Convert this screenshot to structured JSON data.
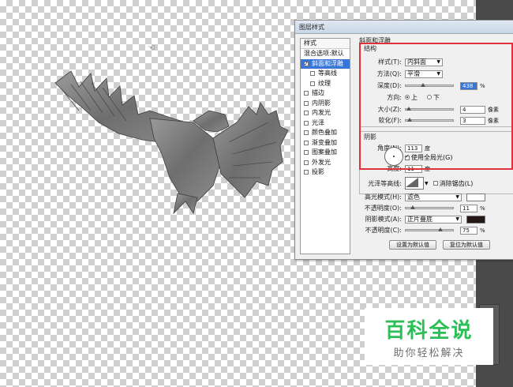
{
  "dialog": {
    "title": "图层样式",
    "left_header": "样式",
    "items": [
      {
        "label": "混合选项:默认",
        "checkbox": false,
        "sub": false,
        "selected": false
      },
      {
        "label": "斜面和浮雕",
        "checkbox": true,
        "checked": true,
        "sub": false,
        "selected": true
      },
      {
        "label": "等高线",
        "checkbox": true,
        "checked": false,
        "sub": true,
        "selected": false
      },
      {
        "label": "纹理",
        "checkbox": true,
        "checked": false,
        "sub": true,
        "selected": false
      },
      {
        "label": "描边",
        "checkbox": true,
        "checked": false,
        "sub": false,
        "selected": false
      },
      {
        "label": "内阴影",
        "checkbox": true,
        "checked": false,
        "sub": false,
        "selected": false
      },
      {
        "label": "内发光",
        "checkbox": true,
        "checked": false,
        "sub": false,
        "selected": false
      },
      {
        "label": "光泽",
        "checkbox": true,
        "checked": false,
        "sub": false,
        "selected": false
      },
      {
        "label": "颜色叠加",
        "checkbox": true,
        "checked": false,
        "sub": false,
        "selected": false
      },
      {
        "label": "渐变叠加",
        "checkbox": true,
        "checked": false,
        "sub": false,
        "selected": false
      },
      {
        "label": "图案叠加",
        "checkbox": true,
        "checked": false,
        "sub": false,
        "selected": false
      },
      {
        "label": "外发光",
        "checkbox": true,
        "checked": false,
        "sub": false,
        "selected": false
      },
      {
        "label": "投影",
        "checkbox": true,
        "checked": false,
        "sub": false,
        "selected": false
      }
    ],
    "bevel": {
      "section_title": "斜面和浮雕",
      "structure_title": "结构",
      "style_label": "样式(T):",
      "style_value": "内斜面",
      "technique_label": "方法(Q):",
      "technique_value": "平滑",
      "depth_label": "深度(D):",
      "depth_value": "438",
      "depth_unit": "%",
      "depth_fraction": 0.35,
      "direction_label": "方向:",
      "dir_up": "上",
      "dir_down": "下",
      "size_label": "大小(Z):",
      "size_value": "4",
      "size_unit": "像素",
      "size_fraction": 0.02,
      "soften_label": "软化(F):",
      "soften_value": "3",
      "soften_unit": "像素",
      "soften_fraction": 0.03,
      "shading_title": "阴影",
      "angle_label": "角度(N):",
      "angle_value": "113",
      "angle_unit": "度",
      "global_light_label": "使用全局光(G)",
      "global_light_checked": true,
      "altitude_label": "高度:",
      "altitude_value": "11",
      "altitude_unit": "度",
      "gloss_label": "光泽等高线:",
      "antialias_label": "消除锯齿(L)",
      "antialias_checked": false,
      "highlight_mode_label": "高光模式(H):",
      "highlight_mode_value": "滤色",
      "highlight_color": "#ffffff",
      "highlight_opacity_label": "不透明度(O):",
      "highlight_opacity_value": "11",
      "highlight_opacity_unit": "%",
      "highlight_opacity_fraction": 0.11,
      "shadow_mode_label": "阴影模式(A):",
      "shadow_mode_value": "正片叠底",
      "shadow_color": "#231815",
      "shadow_opacity_label": "不透明度(C):",
      "shadow_opacity_value": "75",
      "shadow_opacity_unit": "%",
      "shadow_opacity_fraction": 0.75,
      "btn_default": "设置为默认值",
      "btn_reset": "复位为默认值"
    }
  },
  "watermark": {
    "main": "百科全说",
    "sub": "助你轻松解决"
  },
  "colors": {
    "highlight_box": "#e0303a",
    "watermark_green": "#2bbf55",
    "selection_blue": "#3875d7"
  }
}
